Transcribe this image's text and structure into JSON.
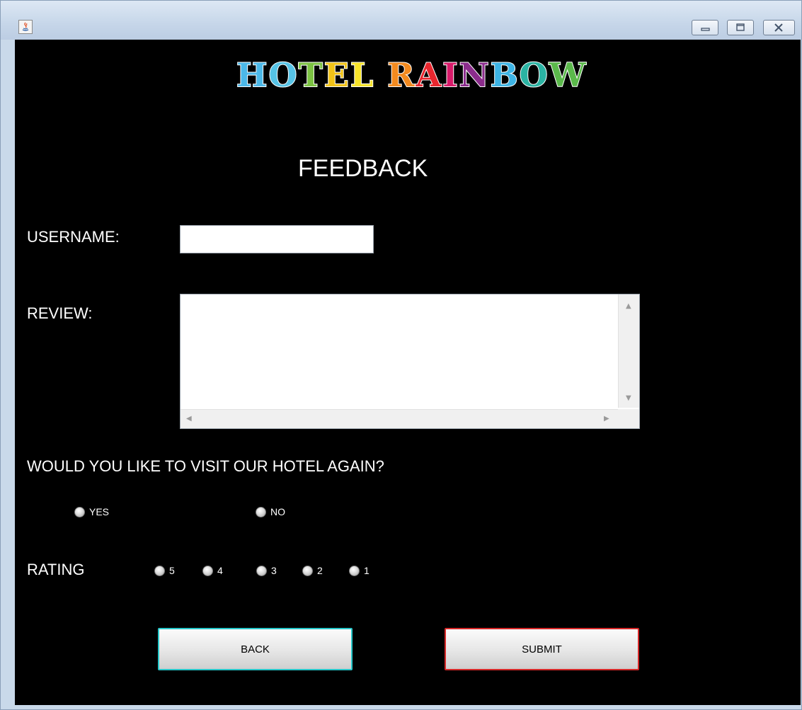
{
  "window": {
    "icon": "java-icon",
    "controls": [
      "minimize-icon",
      "maximize-icon",
      "close-icon"
    ]
  },
  "logo": {
    "text": "HOTEL RAINBOW",
    "letters": [
      {
        "ch": "H",
        "color": "#4cb8e8"
      },
      {
        "ch": "O",
        "color": "#56c3e6"
      },
      {
        "ch": "T",
        "color": "#7cc242"
      },
      {
        "ch": "E",
        "color": "#f2c318"
      },
      {
        "ch": "L",
        "color": "#f7e32a"
      },
      {
        "ch": " ",
        "color": "#ffffff"
      },
      {
        "ch": "R",
        "color": "#f38a1f"
      },
      {
        "ch": "A",
        "color": "#e8262e"
      },
      {
        "ch": "I",
        "color": "#d81b6a"
      },
      {
        "ch": "N",
        "color": "#8b2c8c"
      },
      {
        "ch": "B",
        "color": "#3db4e5"
      },
      {
        "ch": "O",
        "color": "#2bb3a3"
      },
      {
        "ch": "W",
        "color": "#5bb94b"
      }
    ]
  },
  "form": {
    "title": "FEEDBACK",
    "username_label": "USERNAME:",
    "username_value": "",
    "review_label": "REVIEW:",
    "review_value": "",
    "visit_question": "WOULD YOU LIKE TO VISIT OUR HOTEL AGAIN?",
    "visit_options": [
      "YES",
      "NO"
    ],
    "rating_label": "RATING",
    "rating_options": [
      "5",
      "4",
      "3",
      "2",
      "1"
    ]
  },
  "buttons": {
    "back": {
      "label": "BACK",
      "border_color": "#26c6c9"
    },
    "submit": {
      "label": "SUBMIT",
      "border_color": "#d62828"
    }
  }
}
